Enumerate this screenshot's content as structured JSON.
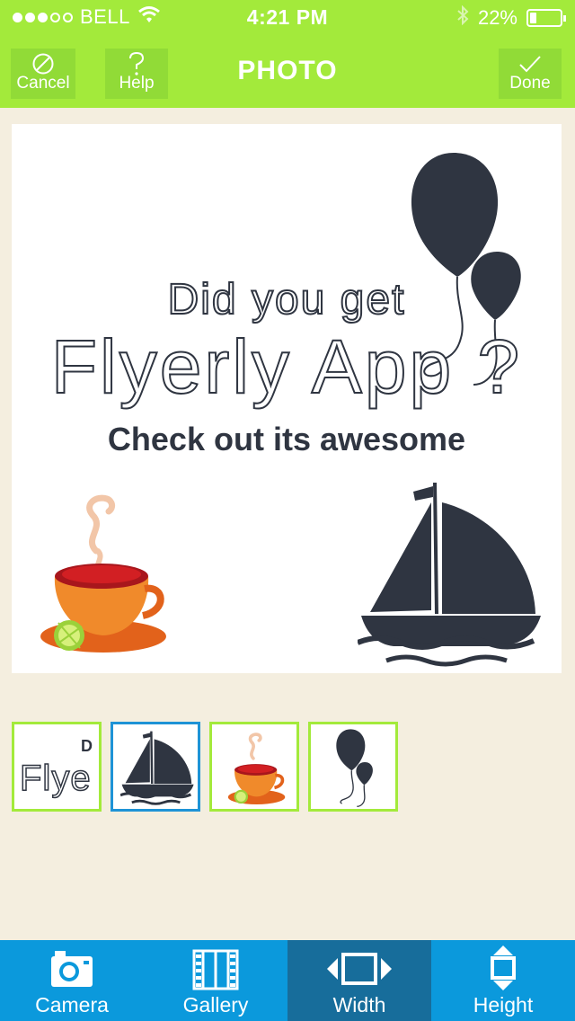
{
  "status_bar": {
    "carrier": "BELL",
    "time": "4:21 PM",
    "battery": "22%",
    "battery_level": 0.22,
    "signal_bars_filled": 3,
    "signal_bars_total": 5
  },
  "nav": {
    "title": "PHOTO",
    "cancel_label": "Cancel",
    "help_label": "Help",
    "done_label": "Done"
  },
  "canvas": {
    "line1": "Did you get",
    "line2": "Flyerly App ?",
    "line3": "Check out its awesome"
  },
  "layers": {
    "text_thumb_main": "Flye",
    "text_thumb_small": "D",
    "items": [
      {
        "name": "text-layer",
        "selected": false
      },
      {
        "name": "sailboat-layer",
        "selected": true
      },
      {
        "name": "teacup-layer",
        "selected": false
      },
      {
        "name": "balloons-layer",
        "selected": false
      }
    ]
  },
  "toolbar": {
    "camera_label": "Camera",
    "gallery_label": "Gallery",
    "width_label": "Width",
    "height_label": "Height",
    "active": "Width"
  },
  "colors": {
    "nav_green": "#a3ea3b",
    "toolbar_blue": "#0b99dc",
    "toolbar_active": "#176d9b",
    "background": "#f4eedf",
    "ink": "#2f3541",
    "selected_border": "#1e93d6"
  },
  "icons": {
    "cancel": "prohibited-circle-icon",
    "help": "question-mark-icon",
    "done": "checkmark-icon",
    "camera": "camera-icon",
    "gallery": "film-strip-icon",
    "width": "horizontal-arrows-icon",
    "height": "vertical-arrows-icon"
  }
}
